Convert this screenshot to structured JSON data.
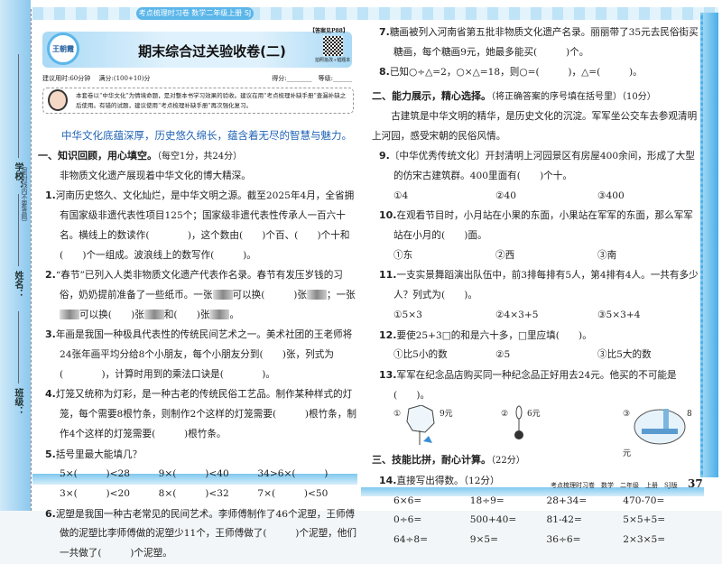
{
  "sidebar": {
    "labels": [
      "学校：",
      "姓名：",
      "班级："
    ],
    "seal": "（密封线内不要答题）"
  },
  "header": {
    "band": "考点梳理时习卷 数学二年级上册 SJ版",
    "logo": "王朝霞",
    "answer_ref": "【答案见P88】",
    "title": "期末综合过关验收卷(二)",
    "qr_caption": "拍照批改+错题本",
    "time": "建议用时:60分钟",
    "score_total": "满分:(100+10)分",
    "score": "得分:________",
    "grade": "等级:______"
  },
  "note": "本套卷以“中华文化”为情境命题，是对整本书学习效果的验收。建议在用“考点梳理补缺手册”查漏补缺之后使用。有错的试题，建议使用“考点梳理补缺手册”再次强化复习。",
  "slogan": "中华文化底蕴深厚，历史悠久绵长，蕴含着无尽的智慧与魅力。",
  "s1": {
    "title": "一、知识回顾，用心填空。",
    "score": "（每空1分，共24分）",
    "intro": "非物质文化遗产展现着中华文化的博大精深。"
  },
  "q1": {
    "n": "1.",
    "t": "河南历史悠久、文化灿烂，是中华文明之源。截至2025年4月，全省拥有国家级非遗代表性项目125个；国家级非遗代表性传承人一百六十名。横线上的数读作(　　　　)，这个数由(　　)个百、(　　)个十和(　　)个一组成。波浪线上的数写作(　　　)。"
  },
  "q2": {
    "n": "2.",
    "a": "“春节”已列入人类非物质文化遗产代表作名录。春节有发压岁钱的习俗，奶奶提前准备了一些纸币。一张",
    "b": "可以换(　　　)张",
    "c": "；一张",
    "d": "可以换(　　)张",
    "e": "和(　　)张",
    "f": "。"
  },
  "q3": {
    "n": "3.",
    "t": "年画是我国一种极具代表性的传统民间艺术之一。美术社团的王老师将24张年画平均分给8个小朋友，每个小朋友分到(　　)张，列式为(　　　　)，计算时用到的乘法口诀是(　　　　)。"
  },
  "q4": {
    "n": "4.",
    "t": "灯笼又统称为灯彩，是一种古老的传统民俗工艺品。制作某种样式的灯笼，每个需要8根竹条，则制作2个这样的灯笼需要(　　　)根竹条，制作4个这样的灯笼需要(　　　)根竹条。"
  },
  "q5": {
    "n": "5.",
    "t": "括号里最大能填几？",
    "rows": [
      [
        "5×(　　　)<28",
        "9×(　　　)<40",
        "34>6×(　　　)"
      ],
      [
        "3×(　　　)<20",
        "8×(　　　)<32",
        "7×(　　　)<50"
      ]
    ]
  },
  "q6": {
    "n": "6.",
    "t": "泥塑是我国一种古老常见的民间艺术。李师傅制作了46个泥塑，王师傅做的泥塑比李师傅做的泥塑少11个，王师傅做了(　　　)个泥塑，他们一共做了(　　　)个泥塑。"
  },
  "q7": {
    "n": "7.",
    "t": "糖画被列入河南省第五批非物质文化遗产名录。丽丽带了35元去民俗街买糖画，每个糖画9元，她最多能买(　　　)个。"
  },
  "q8": {
    "n": "8.",
    "t": "已知○÷△=2，○×△=18，则○=(　　　)，△=(　　　)。"
  },
  "s2": {
    "title": "二、能力展示，精心选择。",
    "score": "（将正确答案的序号填在括号里）（10分）",
    "intro": "古建筑是中华文明的精华，是历史文化的沉淀。军军坐公交车去参观清明上河园，感受宋朝的民俗风情。"
  },
  "q9": {
    "n": "9.",
    "t": "〔中华优秀传统文化〕开封清明上河园景区有房屋400余间，形成了大型的仿宋古建筑群。400里面有(　　)个十。",
    "opts": [
      "①4",
      "②40",
      "③400"
    ]
  },
  "q10": {
    "n": "10.",
    "t": "在观看节目时，小月站在小果的东面，小果站在军军的东面，那么军军站在小月的(　　)面。",
    "opts": [
      "①东",
      "②西",
      "③南"
    ]
  },
  "q11": {
    "n": "11.",
    "t": "一支实景舞蹈演出队伍中，前3排每排有5人，第4排有4人。一共有多少人？列式为(　　)。",
    "opts": [
      "①5×3",
      "②4×3+5",
      "③5×3+4"
    ]
  },
  "q12": {
    "n": "12.",
    "t": "要使25+3□的和是六十多，□里应填(　　)。",
    "opts": [
      "①比5小的数",
      "②5",
      "③比5大的数"
    ]
  },
  "q13": {
    "n": "13.",
    "t": "军军在纪念品店购买同一种纪念品正好用去24元。他买的不可能是(　　)。",
    "opts": [
      {
        "k": "①",
        "p": "9元"
      },
      {
        "k": "②",
        "p": "6元"
      },
      {
        "k": "③",
        "p": "8元"
      }
    ]
  },
  "s3": {
    "title": "三、技能比拼，耐心计算。",
    "score": "（22分）"
  },
  "q14": {
    "n": "14.",
    "t": "直接写出得数。（12分）",
    "rows": [
      [
        "6×6=",
        "18÷9=",
        "28+34=",
        "470-70="
      ],
      [
        "0÷6=",
        "500+40=",
        "81-42=",
        "5×5+5="
      ],
      [
        "64÷8=",
        "9×5=",
        "36÷6=",
        "2×3×5="
      ]
    ]
  },
  "footer": {
    "text": "考点梳理时习卷　数学　二年级　上册　SJ版",
    "page": "37"
  }
}
